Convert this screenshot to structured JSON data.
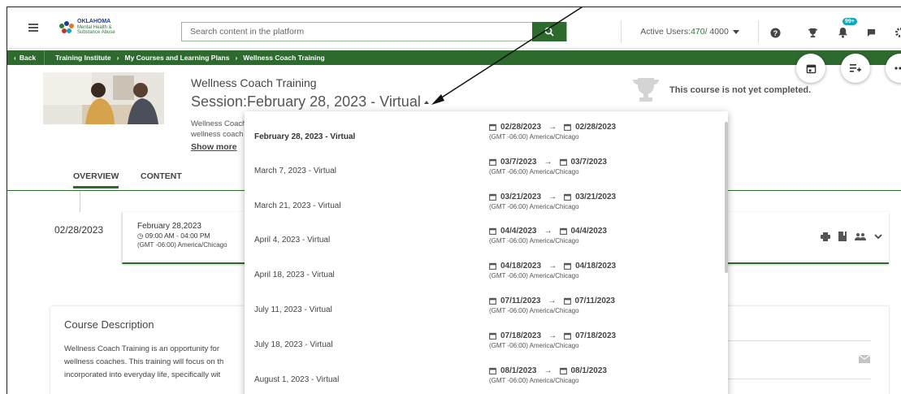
{
  "header": {
    "menu_icon": "hamburger-icon",
    "logo": {
      "line1": "OKLAHOMA",
      "line2": "Mental Health &",
      "line3": "Substance Abuse"
    },
    "search": {
      "placeholder": "Search content in the platform",
      "value": ""
    },
    "active_users": {
      "label": "Active Users: ",
      "count": "470",
      "total": " / 4000"
    },
    "icons": [
      "help-icon",
      "trophy-icon",
      "notification-icon",
      "chat-icon",
      "settings-icon"
    ],
    "notification_badge": "99+"
  },
  "breadcrumb": {
    "back_label": "Back",
    "items": [
      "Training Institute",
      "My Courses and Learning Plans",
      "Wellness Coach Training"
    ],
    "sep": "›"
  },
  "course": {
    "title": "Wellness Coach Training",
    "session_prefix": "Session:",
    "session_value": "February 28, 2023 - Virtual",
    "desc_line1": "Wellness Coach",
    "desc_line2": "wellness coach",
    "show_more": "Show more",
    "status": "This course is not yet completed."
  },
  "tabs": [
    {
      "label": "OVERVIEW",
      "active": true
    },
    {
      "label": "CONTENT",
      "active": false
    }
  ],
  "session_card": {
    "left_date": "02/28/2023",
    "date": "February 28,2023",
    "time": "09:00 AM - 04:00 PM",
    "tz": "(GMT -06:00) America/Chicago"
  },
  "description": {
    "heading": "Course Description",
    "line1": "Wellness Coach Training is an opportunity for",
    "line2": "wellness coaches. This training will focus on th",
    "line3": "incorporated into everyday life, specifically wit"
  },
  "dropdown": {
    "arrow": "→",
    "options": [
      {
        "name": "February 28, 2023 - Virtual",
        "start": "02/28/2023",
        "end": "02/28/2023",
        "tz": "(GMT -06:00) America/Chicago",
        "selected": true
      },
      {
        "name": "March 7, 2023 - Virtual",
        "start": "03/7/2023",
        "end": "03/7/2023",
        "tz": "(GMT -06:00) America/Chicago",
        "selected": false
      },
      {
        "name": "March 21, 2023 - Virtual",
        "start": "03/21/2023",
        "end": "03/21/2023",
        "tz": "(GMT -06:00) America/Chicago",
        "selected": false
      },
      {
        "name": "April 4, 2023 - Virtual",
        "start": "04/4/2023",
        "end": "04/4/2023",
        "tz": "(GMT -06:00) America/Chicago",
        "selected": false
      },
      {
        "name": "April 18, 2023 - Virtual",
        "start": "04/18/2023",
        "end": "04/18/2023",
        "tz": "(GMT -06:00) America/Chicago",
        "selected": false
      },
      {
        "name": "July 11, 2023 - Virtual",
        "start": "07/11/2023",
        "end": "07/11/2023",
        "tz": "(GMT -06:00) America/Chicago",
        "selected": false
      },
      {
        "name": "July 18, 2023 - Virtual",
        "start": "07/18/2023",
        "end": "07/18/2023",
        "tz": "(GMT -06:00) America/Chicago",
        "selected": false
      },
      {
        "name": "August 1, 2023 - Virtual",
        "start": "08/1/2023",
        "end": "08/1/2023",
        "tz": "(GMT -06:00) America/Chicago",
        "selected": false
      }
    ]
  },
  "colors": {
    "brand_green": "#2d6a2e",
    "badge": "#14a5b8"
  }
}
